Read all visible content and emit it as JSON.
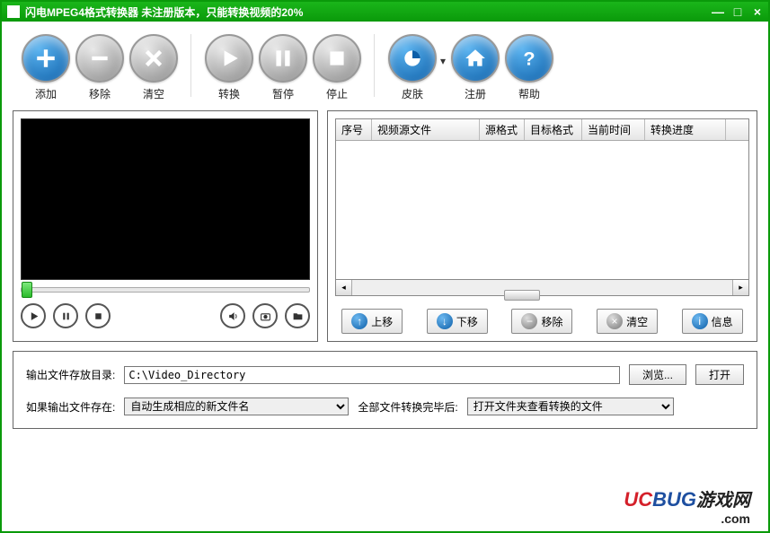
{
  "titlebar": {
    "text": "闪电MPEG4格式转换器    未注册版本，只能转换视频的20%"
  },
  "toolbar": {
    "add": "添加",
    "remove": "移除",
    "clear": "清空",
    "convert": "转换",
    "pause": "暂停",
    "stop": "停止",
    "skin": "皮肤",
    "register": "注册",
    "help": "帮助"
  },
  "table": {
    "headers": [
      "序号",
      "视频源文件",
      "源格式",
      "目标格式",
      "当前时间",
      "转换进度"
    ],
    "widths": [
      40,
      120,
      50,
      64,
      70,
      90
    ]
  },
  "list_actions": {
    "moveup": "上移",
    "movedown": "下移",
    "remove": "移除",
    "clear": "清空",
    "info": "信息"
  },
  "output": {
    "dir_label": "输出文件存放目录:",
    "dir_value": "C:\\Video_Directory",
    "browse": "浏览...",
    "open": "打开",
    "exists_label": "如果输出文件存在:",
    "exists_value": "自动生成相应的新文件名",
    "after_label": "全部文件转换完毕后:",
    "after_value": "打开文件夹查看转换的文件"
  },
  "watermark": {
    "uc": "UC",
    "bug": "BUG",
    "cn": "游戏网",
    "com": ".com"
  }
}
